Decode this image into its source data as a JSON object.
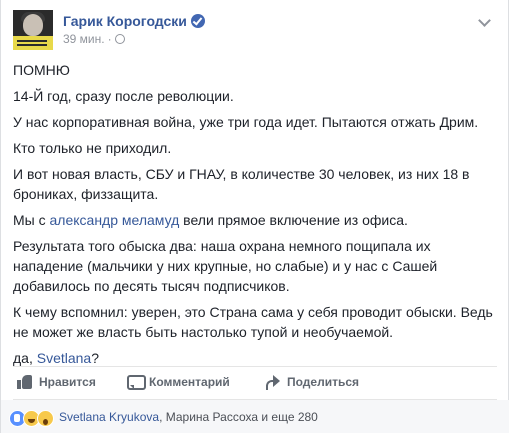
{
  "post": {
    "author": "Гарик Корогодски",
    "time": "39 мин.",
    "separator": "·",
    "avatar_text": "",
    "paragraphs": [
      {
        "text": "ПОМНЮ"
      },
      {
        "text": "14-Й год, сразу после революции."
      },
      {
        "text": "У нас корпоративная война, уже три года идет. Пытаются отжать Дрим."
      },
      {
        "text": "Кто только не приходил."
      },
      {
        "text": "И вот новая власть, СБУ и ГНАУ, в количестве 30 человек, из них 18 в брониках, физзащита."
      },
      {
        "before": "Мы с ",
        "link": "александр меламуд",
        "after": " вели прямое включение из офиса."
      },
      {
        "text": "Результата того обыска два: наша охрана немного пощипала их нападение (мальчики у них крупные, но слабые) и у нас с Сашей добавилось по десять тысяч подписчиков."
      },
      {
        "text": "К чему вспомнил: уверен, это Страна сама у себя проводит обыски. Ведь не может же власть быть настолько тупой и необучаемой."
      },
      {
        "before": "да, ",
        "link": "Svetlana",
        "after": "?"
      }
    ]
  },
  "actions": {
    "like": "Нравится",
    "comment": "Комментарий",
    "share": "Поделиться"
  },
  "reactions": {
    "names_link": "Svetlana Kryukova",
    "names_rest": ", Марина Рассоха и еще 280"
  },
  "colors": {
    "link": "#365899",
    "meta": "#90949c",
    "text": "#1d2129"
  },
  "icons": [
    "verified-icon",
    "globe-icon",
    "chevron-down-icon",
    "like-icon",
    "comment-icon",
    "share-icon",
    "like-reaction-icon",
    "haha-reaction-icon",
    "wow-reaction-icon"
  ]
}
